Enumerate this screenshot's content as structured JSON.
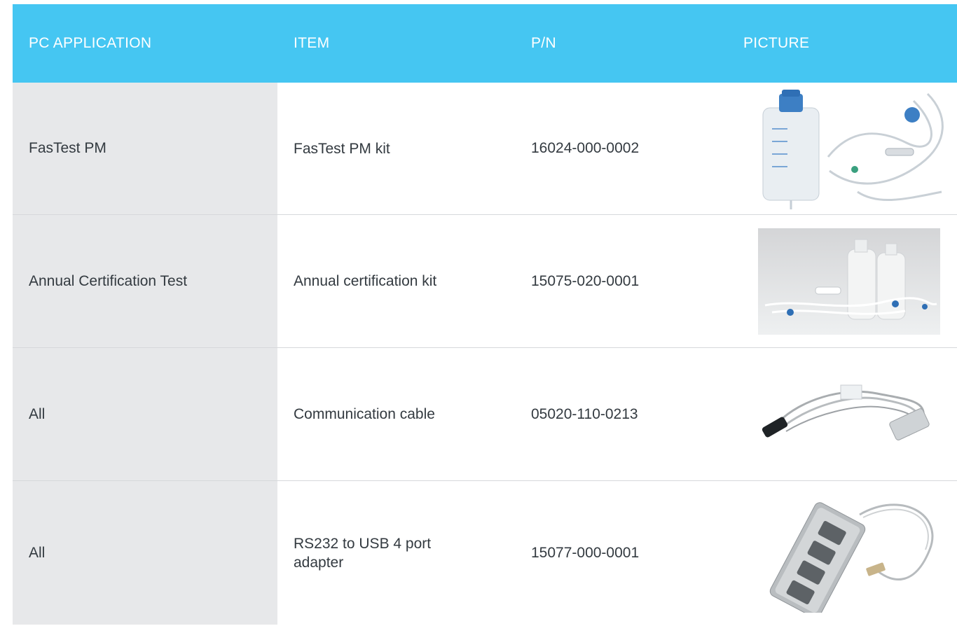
{
  "header": {
    "col_application": "PC APPLICATION",
    "col_item": "ITEM",
    "col_pn": "P/N",
    "col_picture": "PICTURE"
  },
  "rows": [
    {
      "application": "FasTest PM",
      "item": "FasTest PM kit",
      "pn": "16024-000-0002",
      "picture_icon": "iv-bag-tubing-kit-image"
    },
    {
      "application": "Annual Certification Test",
      "item": "Annual certification kit",
      "pn": "15075-020-0001",
      "picture_icon": "bottles-tubing-kit-image"
    },
    {
      "application": "All",
      "item": "Communication cable",
      "pn": "05020-110-0213",
      "picture_icon": "serial-cable-image"
    },
    {
      "application": "All",
      "item": "RS232 to USB 4 port adapter",
      "pn": "15077-000-0001",
      "picture_icon": "usb-hub-adapter-image"
    }
  ],
  "colors": {
    "header_bg": "#45c6f2",
    "first_col_bg": "#e7e8ea"
  }
}
